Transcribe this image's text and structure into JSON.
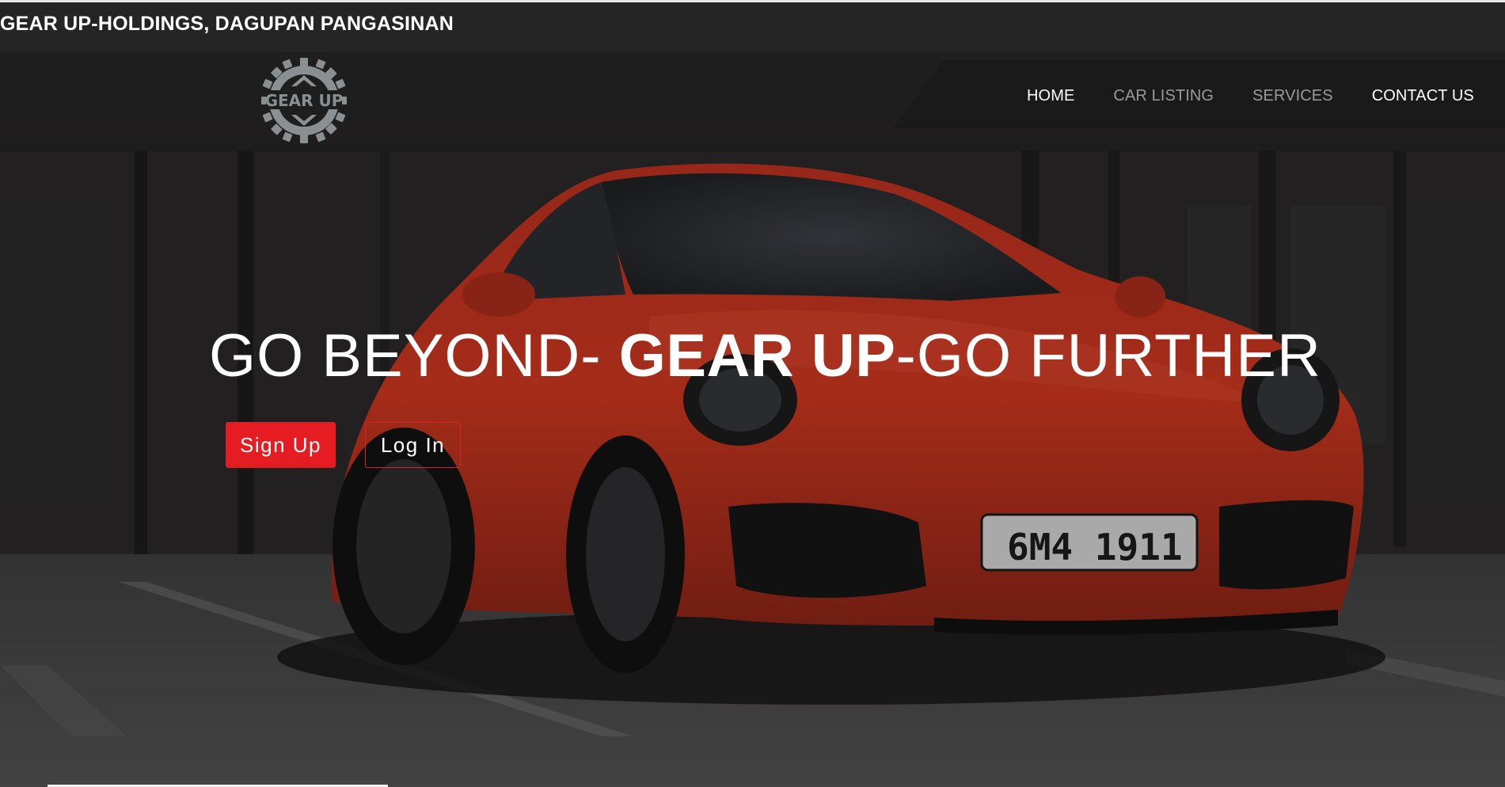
{
  "topbar": {
    "title": "GEAR UP-HOLDINGS, DAGUPAN PANGASINAN"
  },
  "logo": {
    "text": "GEAR UP",
    "icon": "gear-logo-icon"
  },
  "nav": {
    "items": [
      {
        "label": "HOME",
        "state": "active"
      },
      {
        "label": "CAR LISTING",
        "state": "muted"
      },
      {
        "label": "SERVICES",
        "state": "muted"
      },
      {
        "label": "CONTACT US",
        "state": "active"
      }
    ]
  },
  "hero": {
    "headline_part1": "GO BEYOND- ",
    "headline_strong": "GEAR UP",
    "headline_part2": "-GO FURTHER",
    "signup_label": "Sign Up",
    "login_label": "Log In",
    "plate_text": "6M4 1911"
  },
  "colors": {
    "accent_red": "#e61c23",
    "car_red": "#c8321f",
    "nav_panel": "#1b1a1a"
  }
}
